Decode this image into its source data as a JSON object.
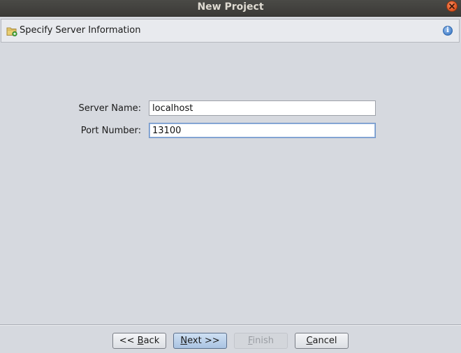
{
  "window": {
    "title": "New Project"
  },
  "header": {
    "title": "Specify Server Information"
  },
  "form": {
    "server_name_label": "Server Name:",
    "server_name_value": "localhost",
    "port_number_label": "Port Number:",
    "port_number_value": "13100"
  },
  "footer": {
    "back_label_prefix": "<< ",
    "back_label_mnemonic": "B",
    "back_label_rest": "ack",
    "next_label_mnemonic": "N",
    "next_label_rest": "ext >>",
    "finish_label_mnemonic": "F",
    "finish_label_rest": "inish",
    "cancel_label_mnemonic": "C",
    "cancel_label_rest": "ancel"
  },
  "icons": {
    "close": "close-icon",
    "folder": "folder-add-icon",
    "info": "info-icon"
  },
  "colors": {
    "titlebar": "#3b3a37",
    "close_button": "#e35a27",
    "default_button": "#a9c3e2",
    "focus_border": "#6f94c8"
  }
}
